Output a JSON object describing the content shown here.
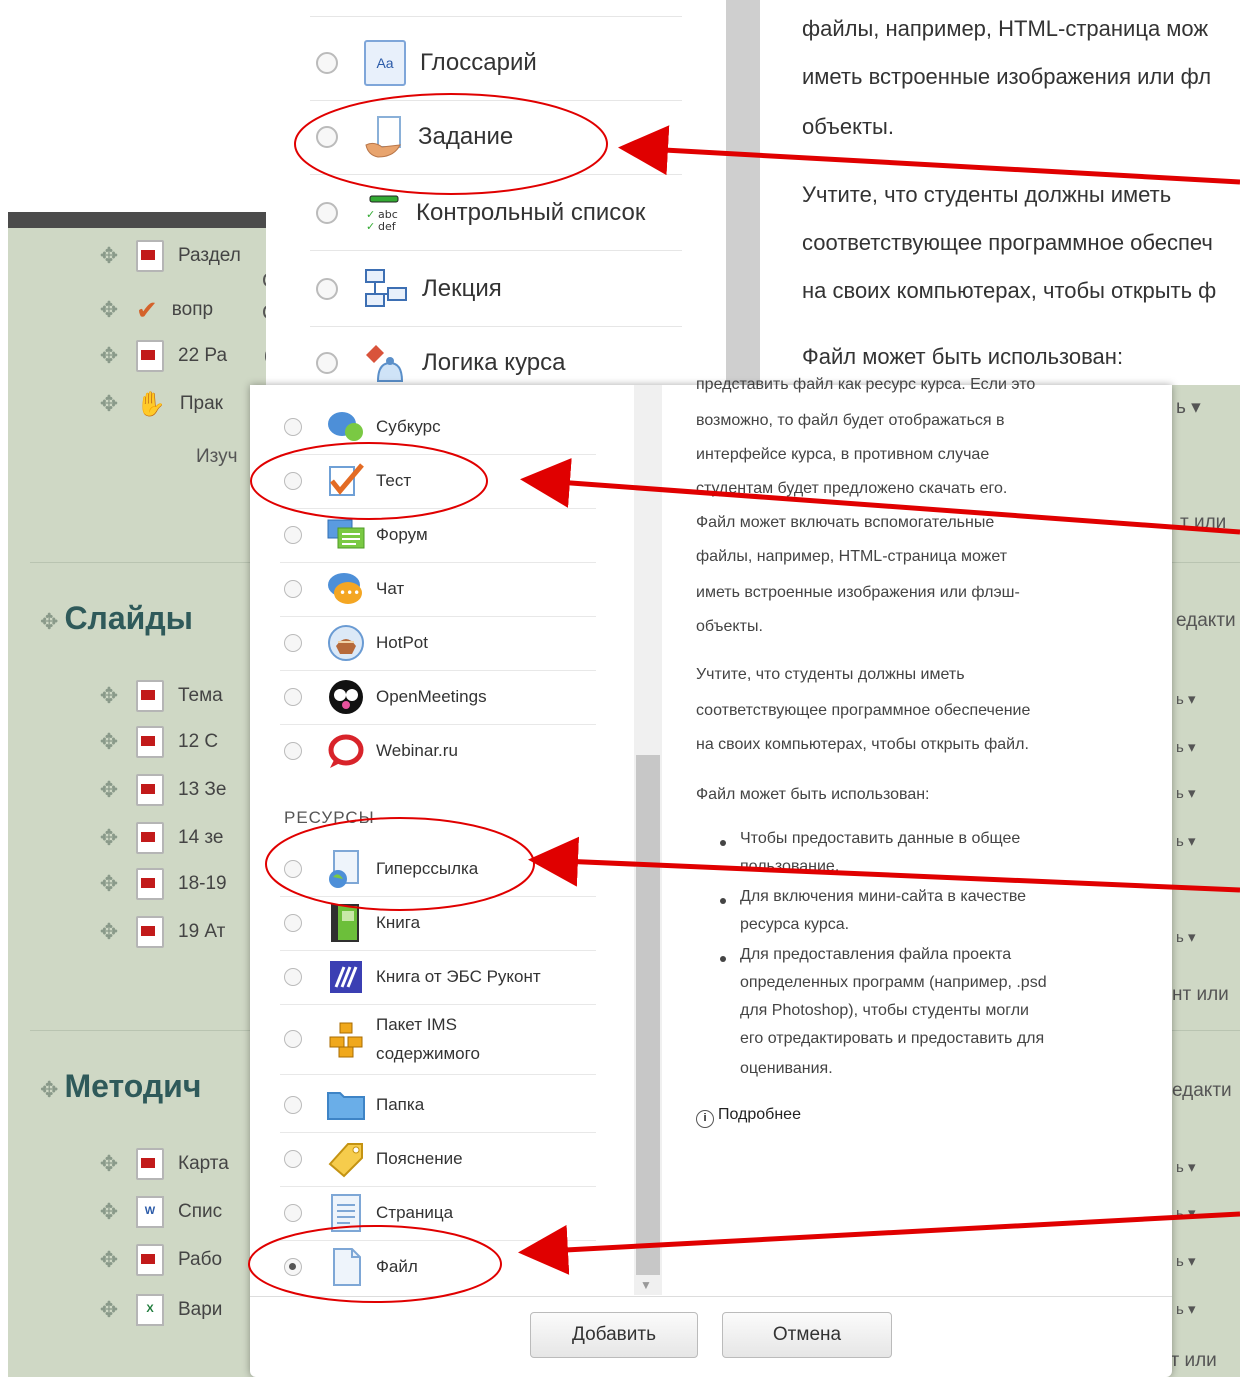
{
  "course": {
    "top_rows": [
      {
        "icon": "pdf-icon",
        "label": "Раздел"
      },
      {
        "icon": "quiz-icon",
        "label": "вопр"
      },
      {
        "icon": "pdf-icon",
        "label": "22 Ра"
      },
      {
        "icon": "assignment-icon",
        "label": "Прак"
      }
    ],
    "top_rows_fragments": [
      "а",
      "С",
      "С",
      "6"
    ],
    "izuch_text": "Изуч",
    "section_slides": "Слайды",
    "slides_rows": [
      "Тема",
      "12 С",
      "13 Зе",
      "14 зе",
      "18-19",
      "19 Ат"
    ],
    "section_methodic": "Методич",
    "methodic_rows": [
      {
        "icon": "pdf-icon",
        "label": "Карта"
      },
      {
        "icon": "word-icon",
        "label": "Спис"
      },
      {
        "icon": "pdf-icon",
        "label": "Рабо"
      },
      {
        "icon": "excel-icon",
        "label": "Вари"
      }
    ],
    "right_fragments": [
      "ь ▾",
      "т или",
      "едакти",
      "ь ▾",
      "ь ▾",
      "ь ▾",
      "ь ▾",
      "ь ▾",
      "нт или",
      "едакти",
      "ь ▾",
      "ь ▾",
      "ь ▾",
      "ь ▾",
      "нт или"
    ]
  },
  "top_panel": {
    "items": [
      {
        "label": "Глоссарий",
        "icon": "glossary-icon"
      },
      {
        "label": "Задание",
        "icon": "assignment-icon"
      },
      {
        "label": "Контрольный список",
        "icon": "checklist-icon"
      },
      {
        "label": "Лекция",
        "icon": "lesson-icon"
      },
      {
        "label": "Логика курса",
        "icon": "course-logic-icon"
      }
    ],
    "description": [
      "файлы, например, HTML-страница мож",
      "иметь встроенные изображения или фл",
      "объекты.",
      "Учтите, что студенты должны иметь",
      "соответствующее программное обеспеч",
      "на своих компьютерах, чтобы открыть ф",
      "Файл может быть использован:"
    ]
  },
  "modal": {
    "activities": [
      {
        "label": "Субкурс",
        "icon": "subcourse-icon",
        "checked": false
      },
      {
        "label": "Тест",
        "icon": "quiz-icon",
        "checked": false
      },
      {
        "label": "Форум",
        "icon": "forum-icon",
        "checked": false
      },
      {
        "label": "Чат",
        "icon": "chat-icon",
        "checked": false
      },
      {
        "label": "HotPot",
        "icon": "hotpot-icon",
        "checked": false
      },
      {
        "label": "OpenMeetings",
        "icon": "openmeetings-icon",
        "checked": false
      },
      {
        "label": "Webinar.ru",
        "icon": "webinar-icon",
        "checked": false
      }
    ],
    "resources_heading": "РЕСУРСЫ",
    "resources": [
      {
        "label": "Гиперссылка",
        "icon": "url-icon",
        "checked": false
      },
      {
        "label": "Книга",
        "icon": "book-icon",
        "checked": false
      },
      {
        "label": "Книга от ЭБС Руконт",
        "icon": "rucont-book-icon",
        "checked": false
      },
      {
        "label": "Пакет IMS содержимого",
        "icon": "ims-package-icon",
        "checked": false
      },
      {
        "label": "Папка",
        "icon": "folder-icon",
        "checked": false
      },
      {
        "label": "Пояснение",
        "icon": "label-icon",
        "checked": false
      },
      {
        "label": "Страница",
        "icon": "page-icon",
        "checked": false
      },
      {
        "label": "Файл",
        "icon": "file-icon",
        "checked": true
      }
    ],
    "description": [
      "представить файл как ресурс курса. Если это",
      "возможно, то файл будет отображаться в",
      "интерфейсе курса, в противном случае",
      "студентам будет предложено скачать его.",
      "Файл может включать вспомогательные",
      "файлы, например, HTML-страница может",
      "иметь встроенные изображения или флэш-",
      "объекты.",
      "Учтите, что студенты должны иметь",
      "соответствующее программное обеспечение",
      "на своих компьютерах, чтобы открыть файл.",
      "Файл может быть использован:"
    ],
    "bullets": [
      [
        "Чтобы предоставить данные в общее",
        "пользование."
      ],
      [
        "Для включения мини-сайта в качестве",
        "ресурса курса."
      ],
      [
        "Для предоставления файла проекта",
        "определенных программ (например, .psd",
        "для Photoshop), чтобы студенты могли",
        "его отредактировать и предоставить для",
        "оценивания."
      ]
    ],
    "more_link": "Подробнее",
    "add_button": "Добавить",
    "cancel_button": "Отмена"
  },
  "colors": {
    "course_bg": "#cfd8c5",
    "annotation": "#e00000",
    "section_heading": "#2f5a5a"
  }
}
